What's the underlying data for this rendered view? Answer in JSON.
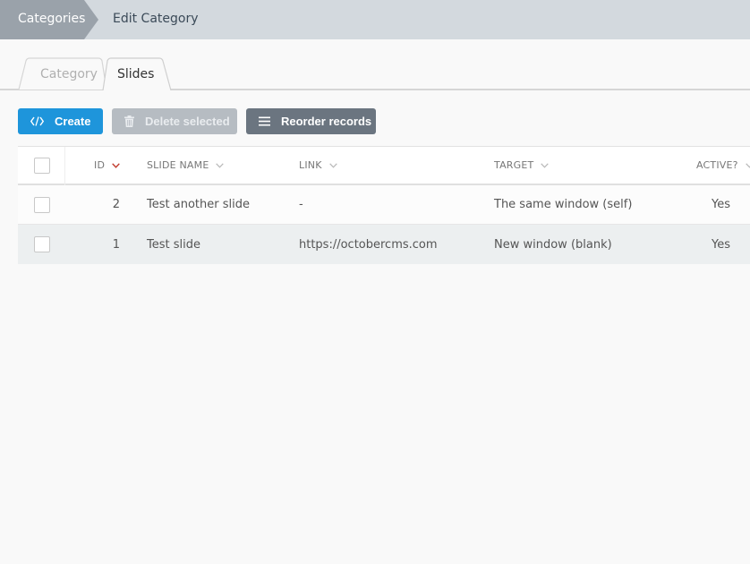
{
  "breadcrumb": {
    "root": "Categories",
    "current": "Edit Category"
  },
  "tabs": [
    {
      "label": "Category",
      "active": false
    },
    {
      "label": "Slides",
      "active": true
    }
  ],
  "toolbar": {
    "create_label": "Create",
    "delete_label": "Delete selected",
    "reorder_label": "Reorder records"
  },
  "table": {
    "columns": {
      "id": "ID",
      "slide_name": "SLIDE NAME",
      "link": "LINK",
      "target": "TARGET",
      "active": "ACTIVE?"
    },
    "rows": [
      {
        "id": "2",
        "slide_name": "Test another slide",
        "link": "-",
        "target": "The same window (self)",
        "active": "Yes"
      },
      {
        "id": "1",
        "slide_name": "Test slide",
        "link": "https://octobercms.com",
        "target": "New window (blank)",
        "active": "Yes"
      }
    ]
  },
  "colors": {
    "primary": "#1e95db",
    "breadcrumb_root": "#9aa2aa",
    "breadcrumb_bg": "#d3d9de",
    "sort_active": "#c0392b"
  },
  "icons": {
    "create": "code-icon",
    "delete": "trash-icon",
    "reorder": "bars-icon"
  }
}
